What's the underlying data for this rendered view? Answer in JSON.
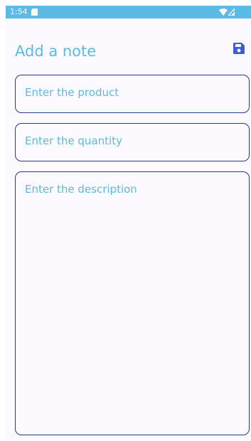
{
  "status_bar": {
    "time": "1:54",
    "color": "#5bbbe4",
    "icons": [
      "sd-card-icon",
      "wifi-icon",
      "signal-icon"
    ]
  },
  "header": {
    "title": "Add a note",
    "save_icon": "save-icon"
  },
  "form": {
    "product_placeholder": "Enter the product",
    "quantity_placeholder": "Enter the quantity",
    "description_placeholder": "Enter the description"
  },
  "colors": {
    "accent": "#5bbbe4",
    "border": "#2e3a80",
    "save_icon": "#3d5fd4",
    "background": "#fcf9ff"
  }
}
